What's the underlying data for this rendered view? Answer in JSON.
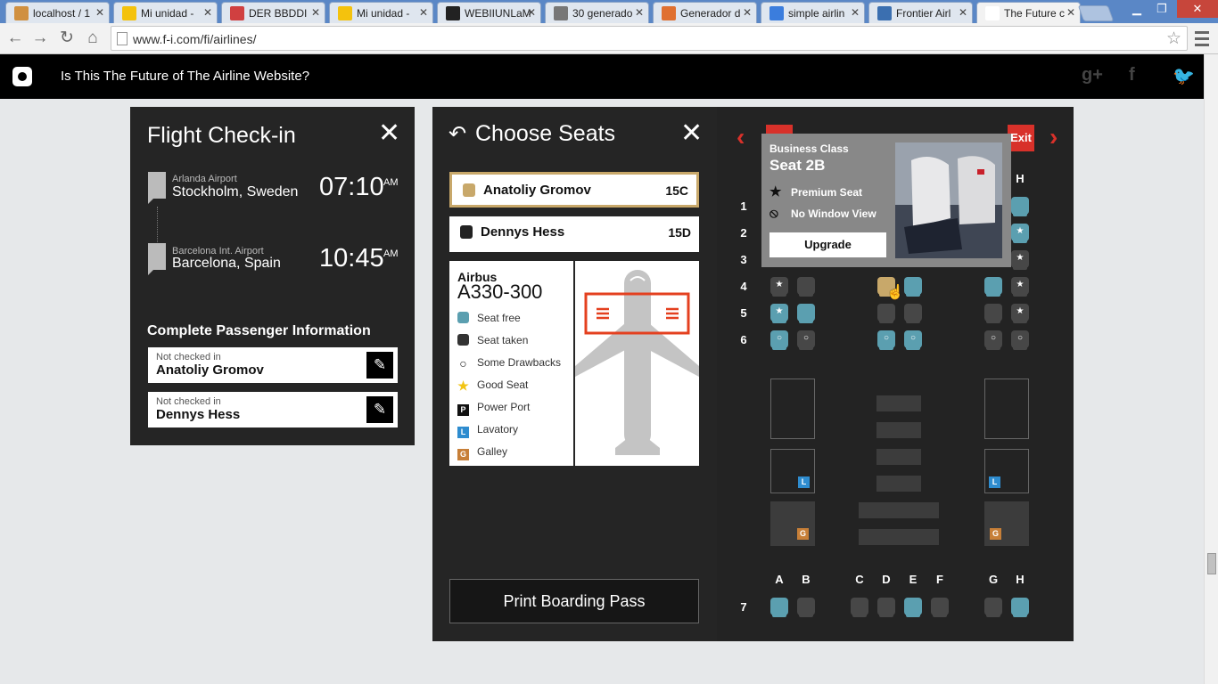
{
  "browser": {
    "tabs": [
      {
        "label": "localhost / 1",
        "favicon": "#d09040"
      },
      {
        "label": "Mi unidad -",
        "favicon": "#f4c20d"
      },
      {
        "label": "DER BBDDI",
        "favicon": "#d04040"
      },
      {
        "label": "Mi unidad -",
        "favicon": "#f4c20d"
      },
      {
        "label": "WEBIIUNLaM",
        "favicon": "#222222"
      },
      {
        "label": "30 generado",
        "favicon": "#777777"
      },
      {
        "label": "Generador d",
        "favicon": "#e07030"
      },
      {
        "label": "simple airlin",
        "favicon": "#3b7ddd"
      },
      {
        "label": "Frontier Airl",
        "favicon": "#3b6fb0"
      },
      {
        "label": "The Future c",
        "favicon": "#ffffff"
      }
    ],
    "url": "www.f-i.com/fi/airlines/"
  },
  "site": {
    "title": "Is This The Future of The Airline Website?"
  },
  "checkin": {
    "title": "Flight Check-in",
    "departure": {
      "airport": "Arlanda Airport",
      "city": "Stockholm, Sweden",
      "time": "07:10",
      "ampm": "AM"
    },
    "arrival": {
      "airport": "Barcelona Int. Airport",
      "city": "Barcelona, Spain",
      "time": "10:45",
      "ampm": "AM"
    },
    "section_title": "Complete Passenger Information",
    "passengers": [
      {
        "status": "Not checked in",
        "name": "Anatoliy Gromov"
      },
      {
        "status": "Not checked in",
        "name": "Dennys Hess"
      }
    ]
  },
  "seats": {
    "title": "Choose Seats",
    "passengers": [
      {
        "name": "Anatoliy Gromov",
        "seat": "15C"
      },
      {
        "name": "Dennys Hess",
        "seat": "15D"
      }
    ],
    "aircraft": {
      "make": "Airbus",
      "model": "A330-300"
    },
    "legend": [
      {
        "label": "Seat free",
        "icon": "seat-free-icon",
        "color": "#5b9fb0",
        "glyph": ""
      },
      {
        "label": "Seat taken",
        "icon": "seat-taken-icon",
        "color": "#333333",
        "glyph": ""
      },
      {
        "label": "Some Drawbacks",
        "icon": "drawback-icon",
        "color": "#111111",
        "glyph": "○"
      },
      {
        "label": "Good Seat",
        "icon": "star-icon",
        "color": "#f2c413",
        "glyph": "★"
      },
      {
        "label": "Power Port",
        "icon": "power-icon",
        "color": "#111111",
        "glyph": "P"
      },
      {
        "label": "Lavatory",
        "icon": "lavatory-icon",
        "color": "#2e8ccf",
        "glyph": "L"
      },
      {
        "label": "Galley",
        "icon": "galley-icon",
        "color": "#c77f38",
        "glyph": "G"
      }
    ],
    "print_label": "Print Boarding Pass"
  },
  "seatmap": {
    "columns_top": [
      "H"
    ],
    "columns_bottom": [
      "A",
      "B",
      "C",
      "D",
      "E",
      "F",
      "G",
      "H"
    ],
    "rows": [
      "1",
      "2",
      "3",
      "4",
      "5",
      "6",
      "7"
    ],
    "exit_label": "Exit",
    "lavatory_badge": "L",
    "galley_badge": "G",
    "tooltip": {
      "class": "Business Class",
      "seat": "Seat 2B",
      "features": [
        {
          "icon": "star-icon",
          "label": "Premium Seat"
        },
        {
          "icon": "no-window-icon",
          "label": "No Window View"
        }
      ],
      "upgrade_label": "Upgrade"
    }
  },
  "colors": {
    "free": "#5b9fb0",
    "taken": "#474747",
    "selected": "#c8a86a",
    "accent": "#d8312a"
  }
}
